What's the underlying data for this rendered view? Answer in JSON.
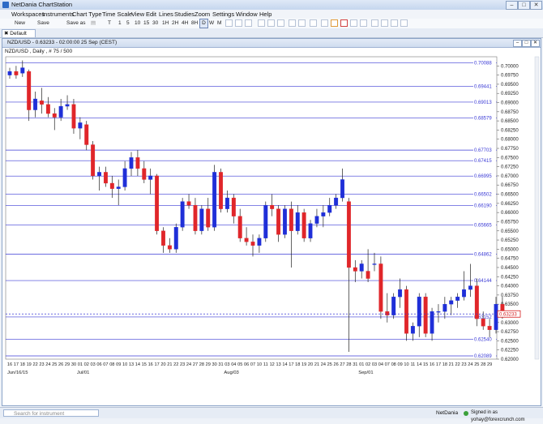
{
  "app": {
    "title": "NetDania ChartStation"
  },
  "menu": [
    "Workspaces",
    "Instruments",
    "Chart Type",
    "Time Scale",
    "View",
    "Edit",
    "Lines",
    "Studies",
    "Zoom",
    "Settings",
    "Window",
    "Help"
  ],
  "toolbar": {
    "new_label": "New",
    "save_label": "Save",
    "save_as_label": "Save as",
    "intervals": [
      "T",
      "1",
      "5",
      "10",
      "15",
      "30",
      "1H",
      "2H",
      "4H",
      "8H",
      "D",
      "W",
      "M"
    ]
  },
  "tab": {
    "label": "Default"
  },
  "chart_window": {
    "title": "NZD/USD - 0.63233 - 02:00:00 25 Sep (CEST)",
    "instrument_line": "NZD/USD , Daily , # 75 / 500"
  },
  "status": {
    "search_placeholder": "Search for instrument",
    "brand": "NetDania",
    "signed_in": "Signed in as yohay@forexcrunch.com"
  },
  "colors": {
    "up": "#1f2fd8",
    "down": "#e0262a",
    "line": "#3b3bd6",
    "price": "#d61f1f"
  },
  "chart_data": {
    "type": "candlestick",
    "instrument": "NZD/USD",
    "timeframe": "Daily",
    "last_price": "0.63233",
    "ylim": [
      0.62,
      0.7025
    ],
    "yticks": [
      "0.70000",
      "0.69750",
      "0.69500",
      "0.69250",
      "0.69000",
      "0.68750",
      "0.68500",
      "0.68250",
      "0.68000",
      "0.67750",
      "0.67500",
      "0.67250",
      "0.67000",
      "0.66750",
      "0.66500",
      "0.66250",
      "0.66000",
      "0.65750",
      "0.65500",
      "0.65250",
      "0.65000",
      "0.64750",
      "0.64500",
      "0.64250",
      "0.64000",
      "0.63750",
      "0.63500",
      "0.63250",
      "0.63000",
      "0.62750",
      "0.62500",
      "0.62250",
      "0.62000"
    ],
    "levels": [
      "0.70088",
      "0.69441",
      "0.69013",
      "0.68579",
      "0.67703",
      "0.67415",
      "0.66995",
      "0.66502",
      "0.66190",
      "0.65665",
      "0.64862",
      "0.64144",
      "0.63152",
      "0.62540",
      "0.62089"
    ],
    "day_labels": [
      "16",
      "17",
      "18",
      "19",
      "22",
      "23",
      "24",
      "25",
      "26",
      "29",
      "30",
      "01",
      "02",
      "03",
      "06",
      "07",
      "08",
      "09",
      "10",
      "13",
      "14",
      "15",
      "16",
      "17",
      "20",
      "21",
      "22",
      "23",
      "24",
      "27",
      "28",
      "29",
      "30",
      "31",
      "03",
      "04",
      "05",
      "06",
      "07",
      "10",
      "11",
      "12",
      "13",
      "14",
      "17",
      "18",
      "19",
      "20",
      "21",
      "24",
      "25",
      "26",
      "27",
      "28",
      "31",
      "01",
      "02",
      "03",
      "04",
      "07",
      "08",
      "09",
      "10",
      "11",
      "14",
      "15",
      "16",
      "17",
      "18",
      "21",
      "22",
      "23",
      "24",
      "25",
      "28",
      "29"
    ],
    "month_labels": [
      {
        "label": "Jun/16/15",
        "index": 0
      },
      {
        "label": "Jul/01",
        "index": 11
      },
      {
        "label": "Aug/03",
        "index": 34
      },
      {
        "label": "Sep/01",
        "index": 55
      }
    ],
    "candles": [
      [
        0.6975,
        0.6995,
        0.6965,
        0.6985
      ],
      [
        0.6985,
        0.7,
        0.6965,
        0.6975
      ],
      [
        0.698,
        0.7015,
        0.697,
        0.6995
      ],
      [
        0.6985,
        0.699,
        0.685,
        0.688
      ],
      [
        0.688,
        0.693,
        0.686,
        0.691
      ],
      [
        0.6905,
        0.694,
        0.687,
        0.6895
      ],
      [
        0.6895,
        0.6915,
        0.686,
        0.687
      ],
      [
        0.687,
        0.6885,
        0.6825,
        0.686
      ],
      [
        0.686,
        0.691,
        0.685,
        0.689
      ],
      [
        0.689,
        0.692,
        0.688,
        0.6895
      ],
      [
        0.6895,
        0.691,
        0.6815,
        0.683
      ],
      [
        0.683,
        0.686,
        0.68,
        0.6845
      ],
      [
        0.684,
        0.685,
        0.677,
        0.6785
      ],
      [
        0.6785,
        0.6795,
        0.669,
        0.67
      ],
      [
        0.67,
        0.6725,
        0.666,
        0.671
      ],
      [
        0.671,
        0.6725,
        0.667,
        0.668
      ],
      [
        0.668,
        0.67,
        0.664,
        0.6665
      ],
      [
        0.6665,
        0.669,
        0.662,
        0.667
      ],
      [
        0.667,
        0.674,
        0.666,
        0.672
      ],
      [
        0.672,
        0.6765,
        0.67,
        0.675
      ],
      [
        0.675,
        0.677,
        0.67,
        0.672
      ],
      [
        0.672,
        0.674,
        0.668,
        0.669
      ],
      [
        0.669,
        0.672,
        0.665,
        0.67
      ],
      [
        0.67,
        0.6705,
        0.654,
        0.655
      ],
      [
        0.655,
        0.656,
        0.649,
        0.651
      ],
      [
        0.651,
        0.653,
        0.649,
        0.65
      ],
      [
        0.65,
        0.657,
        0.649,
        0.656
      ],
      [
        0.656,
        0.664,
        0.655,
        0.663
      ],
      [
        0.663,
        0.665,
        0.661,
        0.662
      ],
      [
        0.662,
        0.664,
        0.654,
        0.655
      ],
      [
        0.655,
        0.662,
        0.654,
        0.661
      ],
      [
        0.661,
        0.664,
        0.655,
        0.656
      ],
      [
        0.656,
        0.673,
        0.655,
        0.671
      ],
      [
        0.671,
        0.672,
        0.66,
        0.661
      ],
      [
        0.661,
        0.666,
        0.66,
        0.664
      ],
      [
        0.664,
        0.665,
        0.657,
        0.659
      ],
      [
        0.659,
        0.661,
        0.652,
        0.653
      ],
      [
        0.653,
        0.656,
        0.651,
        0.652
      ],
      [
        0.652,
        0.654,
        0.648,
        0.651
      ],
      [
        0.651,
        0.654,
        0.649,
        0.653
      ],
      [
        0.653,
        0.663,
        0.652,
        0.662
      ],
      [
        0.662,
        0.665,
        0.659,
        0.661
      ],
      [
        0.661,
        0.662,
        0.652,
        0.654
      ],
      [
        0.654,
        0.662,
        0.653,
        0.661
      ],
      [
        0.661,
        0.663,
        0.645,
        0.655
      ],
      [
        0.655,
        0.662,
        0.654,
        0.66
      ],
      [
        0.66,
        0.661,
        0.652,
        0.653
      ],
      [
        0.653,
        0.658,
        0.652,
        0.657
      ],
      [
        0.657,
        0.661,
        0.656,
        0.659
      ],
      [
        0.659,
        0.662,
        0.656,
        0.66
      ],
      [
        0.66,
        0.664,
        0.659,
        0.662
      ],
      [
        0.662,
        0.665,
        0.661,
        0.664
      ],
      [
        0.664,
        0.672,
        0.663,
        0.669
      ],
      [
        0.663,
        0.664,
        0.622,
        0.645
      ],
      [
        0.645,
        0.647,
        0.641,
        0.644
      ],
      [
        0.644,
        0.647,
        0.642,
        0.646
      ],
      [
        0.644,
        0.65,
        0.641,
        0.642
      ],
      [
        0.646,
        0.649,
        0.644,
        0.646
      ],
      [
        0.646,
        0.648,
        0.631,
        0.633
      ],
      [
        0.633,
        0.638,
        0.63,
        0.632
      ],
      [
        0.632,
        0.638,
        0.631,
        0.637
      ],
      [
        0.637,
        0.642,
        0.634,
        0.639
      ],
      [
        0.639,
        0.64,
        0.625,
        0.627
      ],
      [
        0.627,
        0.63,
        0.625,
        0.629
      ],
      [
        0.629,
        0.638,
        0.626,
        0.637
      ],
      [
        0.637,
        0.638,
        0.626,
        0.627
      ],
      [
        0.627,
        0.634,
        0.625,
        0.633
      ],
      [
        0.633,
        0.635,
        0.63,
        0.633
      ],
      [
        0.633,
        0.637,
        0.631,
        0.635
      ],
      [
        0.635,
        0.637,
        0.632,
        0.636
      ],
      [
        0.636,
        0.638,
        0.634,
        0.637
      ],
      [
        0.637,
        0.644,
        0.636,
        0.639
      ],
      [
        0.639,
        0.646,
        0.637,
        0.64
      ],
      [
        0.64,
        0.642,
        0.629,
        0.631
      ],
      [
        0.631,
        0.633,
        0.628,
        0.629
      ],
      [
        0.629,
        0.631,
        0.626,
        0.628
      ],
      [
        0.628,
        0.637,
        0.627,
        0.635
      ],
      [
        0.635,
        0.637,
        0.631,
        0.6323
      ]
    ]
  }
}
